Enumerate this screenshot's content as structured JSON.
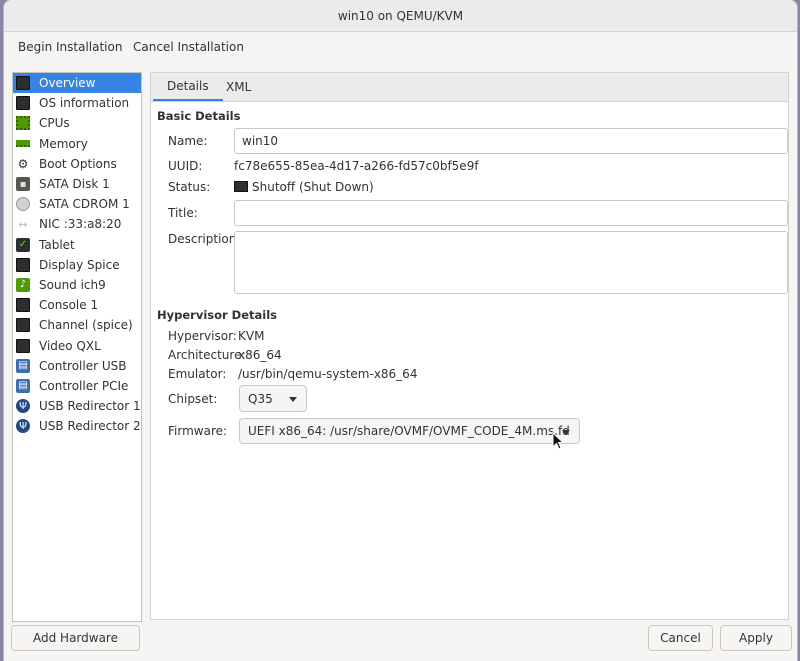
{
  "window": {
    "title": "win10 on QEMU/KVM"
  },
  "toolbar": {
    "begin": "Begin Installation",
    "cancel": "Cancel Installation"
  },
  "sidebar": {
    "items": [
      {
        "label": "Overview",
        "icon": "monitor-icon"
      },
      {
        "label": "OS information",
        "icon": "monitor-icon"
      },
      {
        "label": "CPUs",
        "icon": "cpu-chip-icon"
      },
      {
        "label": "Memory",
        "icon": "memory-icon"
      },
      {
        "label": "Boot Options",
        "icon": "gear-icon"
      },
      {
        "label": "SATA Disk 1",
        "icon": "disk-icon"
      },
      {
        "label": "SATA CDROM 1",
        "icon": "cdrom-icon"
      },
      {
        "label": "NIC :33:a8:20",
        "icon": "network-icon"
      },
      {
        "label": "Tablet",
        "icon": "tablet-icon"
      },
      {
        "label": "Display Spice",
        "icon": "monitor-icon"
      },
      {
        "label": "Sound ich9",
        "icon": "sound-card-icon"
      },
      {
        "label": "Console 1",
        "icon": "terminal-icon"
      },
      {
        "label": "Channel (spice)",
        "icon": "terminal-icon"
      },
      {
        "label": "Video QXL",
        "icon": "monitor-icon"
      },
      {
        "label": "Controller USB",
        "icon": "pci-card-icon"
      },
      {
        "label": "Controller PCIe",
        "icon": "pci-card-icon"
      },
      {
        "label": "USB Redirector 1",
        "icon": "usb-icon"
      },
      {
        "label": "USB Redirector 2",
        "icon": "usb-icon"
      }
    ],
    "selected_index": 0
  },
  "tabs": {
    "details": "Details",
    "xml": "XML"
  },
  "basic": {
    "heading": "Basic Details",
    "name_label": "Name:",
    "name_value": "win10",
    "uuid_label": "UUID:",
    "uuid_value": "fc78e655-85ea-4d17-a266-fd57c0bf5e9f",
    "status_label": "Status:",
    "status_value": "Shutoff (Shut Down)",
    "title_label": "Title:",
    "title_value": "",
    "description_label": "Description:",
    "description_value": ""
  },
  "hypervisor": {
    "heading": "Hypervisor Details",
    "hypervisor_label": "Hypervisor:",
    "hypervisor_value": "KVM",
    "architecture_label": "Architecture:",
    "architecture_value": "x86_64",
    "emulator_label": "Emulator:",
    "emulator_value": "/usr/bin/qemu-system-x86_64",
    "chipset_label": "Chipset:",
    "chipset_value": "Q35",
    "firmware_label": "Firmware:",
    "firmware_value": "UEFI x86_64: /usr/share/OVMF/OVMF_CODE_4M.ms.fd"
  },
  "footer": {
    "add_hardware": "Add Hardware",
    "cancel": "Cancel",
    "apply": "Apply"
  },
  "colors": {
    "accent": "#3584e4",
    "window_bg": "#f6f5f4"
  }
}
